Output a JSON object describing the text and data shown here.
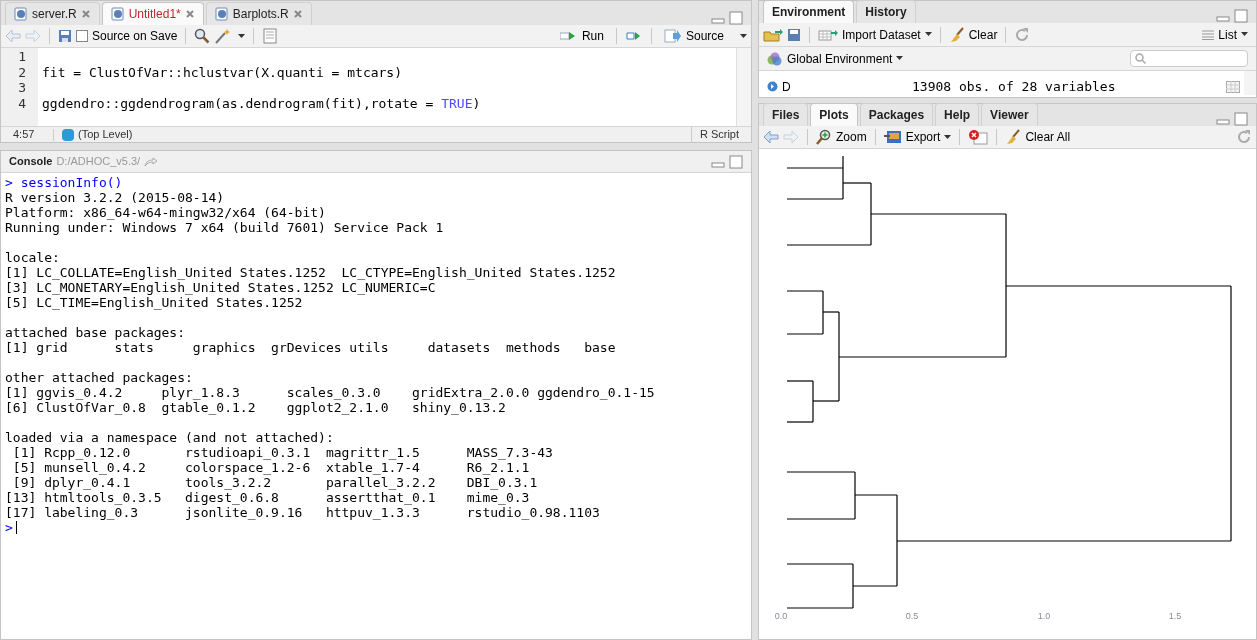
{
  "editor": {
    "tabs": [
      {
        "label": "server.R",
        "selected": false,
        "unsaved": false
      },
      {
        "label": "Untitled1*",
        "selected": true,
        "unsaved": true
      },
      {
        "label": "Barplots.R",
        "selected": false,
        "unsaved": false
      }
    ],
    "toolbar": {
      "source_on_save": {
        "label": "Source on Save",
        "checked": false
      },
      "run": "Run",
      "source": "Source"
    },
    "lines": [
      {
        "number": "1"
      },
      {
        "number": "2",
        "tokens": [
          {
            "kind": "plain",
            "text": "fit = ClustOfVar::hclustvar(X.quanti = mtcars)"
          }
        ]
      },
      {
        "number": "3"
      },
      {
        "number": "4",
        "tokens": [
          {
            "kind": "plain",
            "text": "ggdendro::ggdendrogram(as.dendrogram(fit),rotate = "
          },
          {
            "kind": "constant",
            "text": "TRUE"
          },
          {
            "kind": "plain",
            "text": ")"
          }
        ]
      }
    ],
    "status": {
      "position": "4:57",
      "scope": "(Top Level)",
      "file_type": "R Script"
    }
  },
  "console": {
    "title": "Console",
    "path": "D:/ADHOC_v5.3/",
    "lines": [
      {
        "kind": "input",
        "text": "> sessionInfo()"
      },
      {
        "kind": "output",
        "text": "R version 3.2.2 (2015-08-14)"
      },
      {
        "kind": "output",
        "text": "Platform: x86_64-w64-mingw32/x64 (64-bit)"
      },
      {
        "kind": "output",
        "text": "Running under: Windows 7 x64 (build 7601) Service Pack 1"
      },
      {
        "kind": "blank"
      },
      {
        "kind": "output",
        "text": "locale:"
      },
      {
        "kind": "output",
        "text": "[1] LC_COLLATE=English_United States.1252  LC_CTYPE=English_United States.1252"
      },
      {
        "kind": "output",
        "text": "[3] LC_MONETARY=English_United States.1252 LC_NUMERIC=C"
      },
      {
        "kind": "output",
        "text": "[5] LC_TIME=English_United States.1252"
      },
      {
        "kind": "blank"
      },
      {
        "kind": "output",
        "text": "attached base packages:"
      },
      {
        "kind": "output",
        "text": "[1] grid      stats     graphics  grDevices utils     datasets  methods   base"
      },
      {
        "kind": "blank"
      },
      {
        "kind": "output",
        "text": "other attached packages:"
      },
      {
        "kind": "output",
        "text": "[1] ggvis_0.4.2     plyr_1.8.3      scales_0.3.0    gridExtra_2.0.0 ggdendro_0.1-15"
      },
      {
        "kind": "output",
        "text": "[6] ClustOfVar_0.8  gtable_0.1.2    ggplot2_2.1.0   shiny_0.13.2"
      },
      {
        "kind": "blank"
      },
      {
        "kind": "output",
        "text": "loaded via a namespace (and not attached):"
      },
      {
        "kind": "output",
        "text": " [1] Rcpp_0.12.0       rstudioapi_0.3.1  magrittr_1.5      MASS_7.3-43"
      },
      {
        "kind": "output",
        "text": " [5] munsell_0.4.2     colorspace_1.2-6  xtable_1.7-4      R6_2.1.1"
      },
      {
        "kind": "output",
        "text": " [9] dplyr_0.4.1       tools_3.2.2       parallel_3.2.2    DBI_0.3.1"
      },
      {
        "kind": "output",
        "text": "[13] htmltools_0.3.5   digest_0.6.8      assertthat_0.1    mime_0.3"
      },
      {
        "kind": "output",
        "text": "[17] labeling_0.3      jsonlite_0.9.16   httpuv_1.3.3      rstudio_0.98.1103"
      },
      {
        "kind": "prompt",
        "text": ">"
      }
    ]
  },
  "environment": {
    "tabs": [
      {
        "label": "Environment",
        "selected": true
      },
      {
        "label": "History",
        "selected": false
      }
    ],
    "toolbar": {
      "import": "Import Dataset",
      "clear": "Clear",
      "view": "List"
    },
    "scope": "Global Environment",
    "rows": [
      {
        "name": "D",
        "value": "13908 obs. of 28 variables"
      }
    ]
  },
  "files": {
    "tabs": [
      {
        "label": "Files",
        "selected": false
      },
      {
        "label": "Plots",
        "selected": true
      },
      {
        "label": "Packages",
        "selected": false
      },
      {
        "label": "Help",
        "selected": false
      },
      {
        "label": "Viewer",
        "selected": false
      }
    ],
    "toolbar": {
      "zoom": "Zoom",
      "export": "Export",
      "clear_all": "Clear All"
    },
    "plot": {
      "axis_ticks": [
        "0.0",
        "0.5",
        "1.0",
        "1.5"
      ]
    }
  }
}
